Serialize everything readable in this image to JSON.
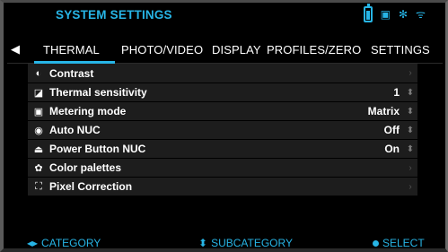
{
  "header": {
    "title": "SYSTEM SETTINGS",
    "icons": [
      "battery-icon",
      "sd-card-icon",
      "bluetooth-icon",
      "wifi-icon"
    ]
  },
  "tabs": [
    {
      "label": "THERMAL",
      "active": true
    },
    {
      "label": "PHOTO/VIDEO",
      "active": false
    },
    {
      "label": "DISPLAY",
      "active": false
    },
    {
      "label": "PROFILES/ZERO",
      "active": false
    },
    {
      "label": "SETTINGS",
      "active": false
    }
  ],
  "rows": [
    {
      "icon": "contrast-icon",
      "label": "Contrast",
      "value": "",
      "control": "chevron"
    },
    {
      "icon": "thermal-sensitivity-icon",
      "label": "Thermal sensitivity",
      "value": "1",
      "control": "updown"
    },
    {
      "icon": "metering-mode-icon",
      "label": "Metering mode",
      "value": "Matrix",
      "control": "updown"
    },
    {
      "icon": "auto-nuc-icon",
      "label": "Auto NUC",
      "value": "Off",
      "control": "updown"
    },
    {
      "icon": "power-button-nuc-icon",
      "label": "Power Button NUC",
      "value": "On",
      "control": "updown"
    },
    {
      "icon": "palette-icon",
      "label": "Color palettes",
      "value": "",
      "control": "chevron"
    },
    {
      "icon": "pixel-correction-icon",
      "label": "Pixel Correction",
      "value": "",
      "control": "chevron"
    }
  ],
  "footer": {
    "category": "CATEGORY",
    "subcategory": "SUBCATEGORY",
    "select": "SELECT"
  },
  "colors": {
    "accent": "#27b5e6",
    "row_bg": "#1d1d1d",
    "background": "#000000"
  }
}
